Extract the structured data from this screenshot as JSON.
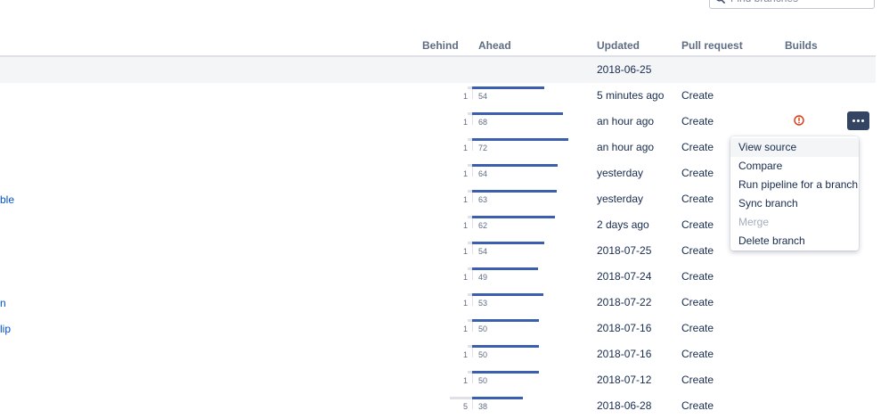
{
  "search": {
    "placeholder": "Find branches"
  },
  "columns": {
    "behind": "Behind",
    "ahead": "Ahead",
    "updated": "Updated",
    "pull_request": "Pull request",
    "builds": "Builds"
  },
  "main_branch_row": {
    "updated": "2018-06-25"
  },
  "rows": [
    {
      "label": "",
      "behind": "1",
      "ahead": "54",
      "updated": "5 minutes ago",
      "pr": "Create"
    },
    {
      "label": "",
      "behind": "1",
      "ahead": "68",
      "updated": "an hour ago",
      "pr": "Create",
      "build_status": "failed"
    },
    {
      "label": "",
      "behind": "1",
      "ahead": "72",
      "updated": "an hour ago",
      "pr": "Create"
    },
    {
      "label": "",
      "behind": "1",
      "ahead": "64",
      "updated": "yesterday",
      "pr": "Create"
    },
    {
      "label": "ble",
      "behind": "1",
      "ahead": "63",
      "updated": "yesterday",
      "pr": "Create"
    },
    {
      "label": "",
      "behind": "1",
      "ahead": "62",
      "updated": "2 days ago",
      "pr": "Create"
    },
    {
      "label": "",
      "behind": "1",
      "ahead": "54",
      "updated": "2018-07-25",
      "pr": "Create"
    },
    {
      "label": "",
      "behind": "1",
      "ahead": "49",
      "updated": "2018-07-24",
      "pr": "Create"
    },
    {
      "label": "n",
      "behind": "1",
      "ahead": "53",
      "updated": "2018-07-22",
      "pr": "Create"
    },
    {
      "label": "lip",
      "behind": "1",
      "ahead": "50",
      "updated": "2018-07-16",
      "pr": "Create"
    },
    {
      "label": "",
      "behind": "1",
      "ahead": "50",
      "updated": "2018-07-16",
      "pr": "Create"
    },
    {
      "label": "",
      "behind": "1",
      "ahead": "50",
      "updated": "2018-07-12",
      "pr": "Create"
    },
    {
      "label": "",
      "behind": "5",
      "ahead": "38",
      "updated": "2018-06-28",
      "pr": "Create"
    }
  ],
  "menu": {
    "items": [
      {
        "label": "View source",
        "state": "active"
      },
      {
        "label": "Compare",
        "state": "normal"
      },
      {
        "label": "Run pipeline for a branch",
        "state": "normal"
      },
      {
        "label": "Sync branch",
        "state": "normal"
      },
      {
        "label": "Merge",
        "state": "disabled"
      },
      {
        "label": "Delete branch",
        "state": "normal"
      }
    ]
  },
  "colors": {
    "ahead_bar": "#3b5fb0",
    "behind_bar": "#dfe1e6",
    "error": "#de350b",
    "more_button": "#344563"
  },
  "icons": {
    "search": "search-icon",
    "build_failed": "error-circle-icon",
    "more": "more-horizontal-icon"
  }
}
